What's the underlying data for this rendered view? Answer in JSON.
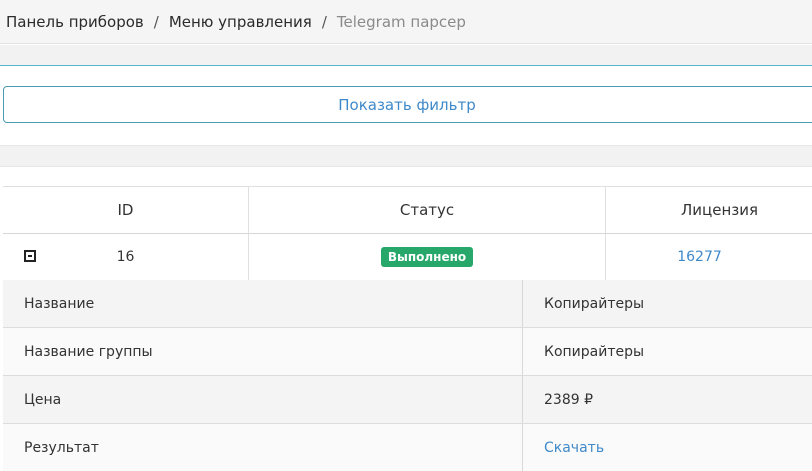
{
  "breadcrumb": {
    "items": [
      "Панель приборов",
      "Меню управления",
      "Telegram парсер"
    ],
    "separator": "/"
  },
  "filter": {
    "button_label": "Показать фильтр"
  },
  "table": {
    "columns": [
      "ID",
      "Статус",
      "Лицензия"
    ],
    "row": {
      "id": "16",
      "status": "Выполнено",
      "license": "16277"
    }
  },
  "details": {
    "rows": [
      {
        "label": "Название",
        "value": "Копирайтеры"
      },
      {
        "label": "Название группы",
        "value": "Копирайтеры"
      },
      {
        "label": "Цена",
        "value": "2389 ₽"
      },
      {
        "label": "Результат",
        "value": "Скачать"
      }
    ]
  },
  "colors": {
    "accent_link": "#3f89c9",
    "status_success": "#27a86a",
    "filter_border": "#4a9ab1"
  },
  "icons": {
    "collapse": "minus-square-icon"
  }
}
